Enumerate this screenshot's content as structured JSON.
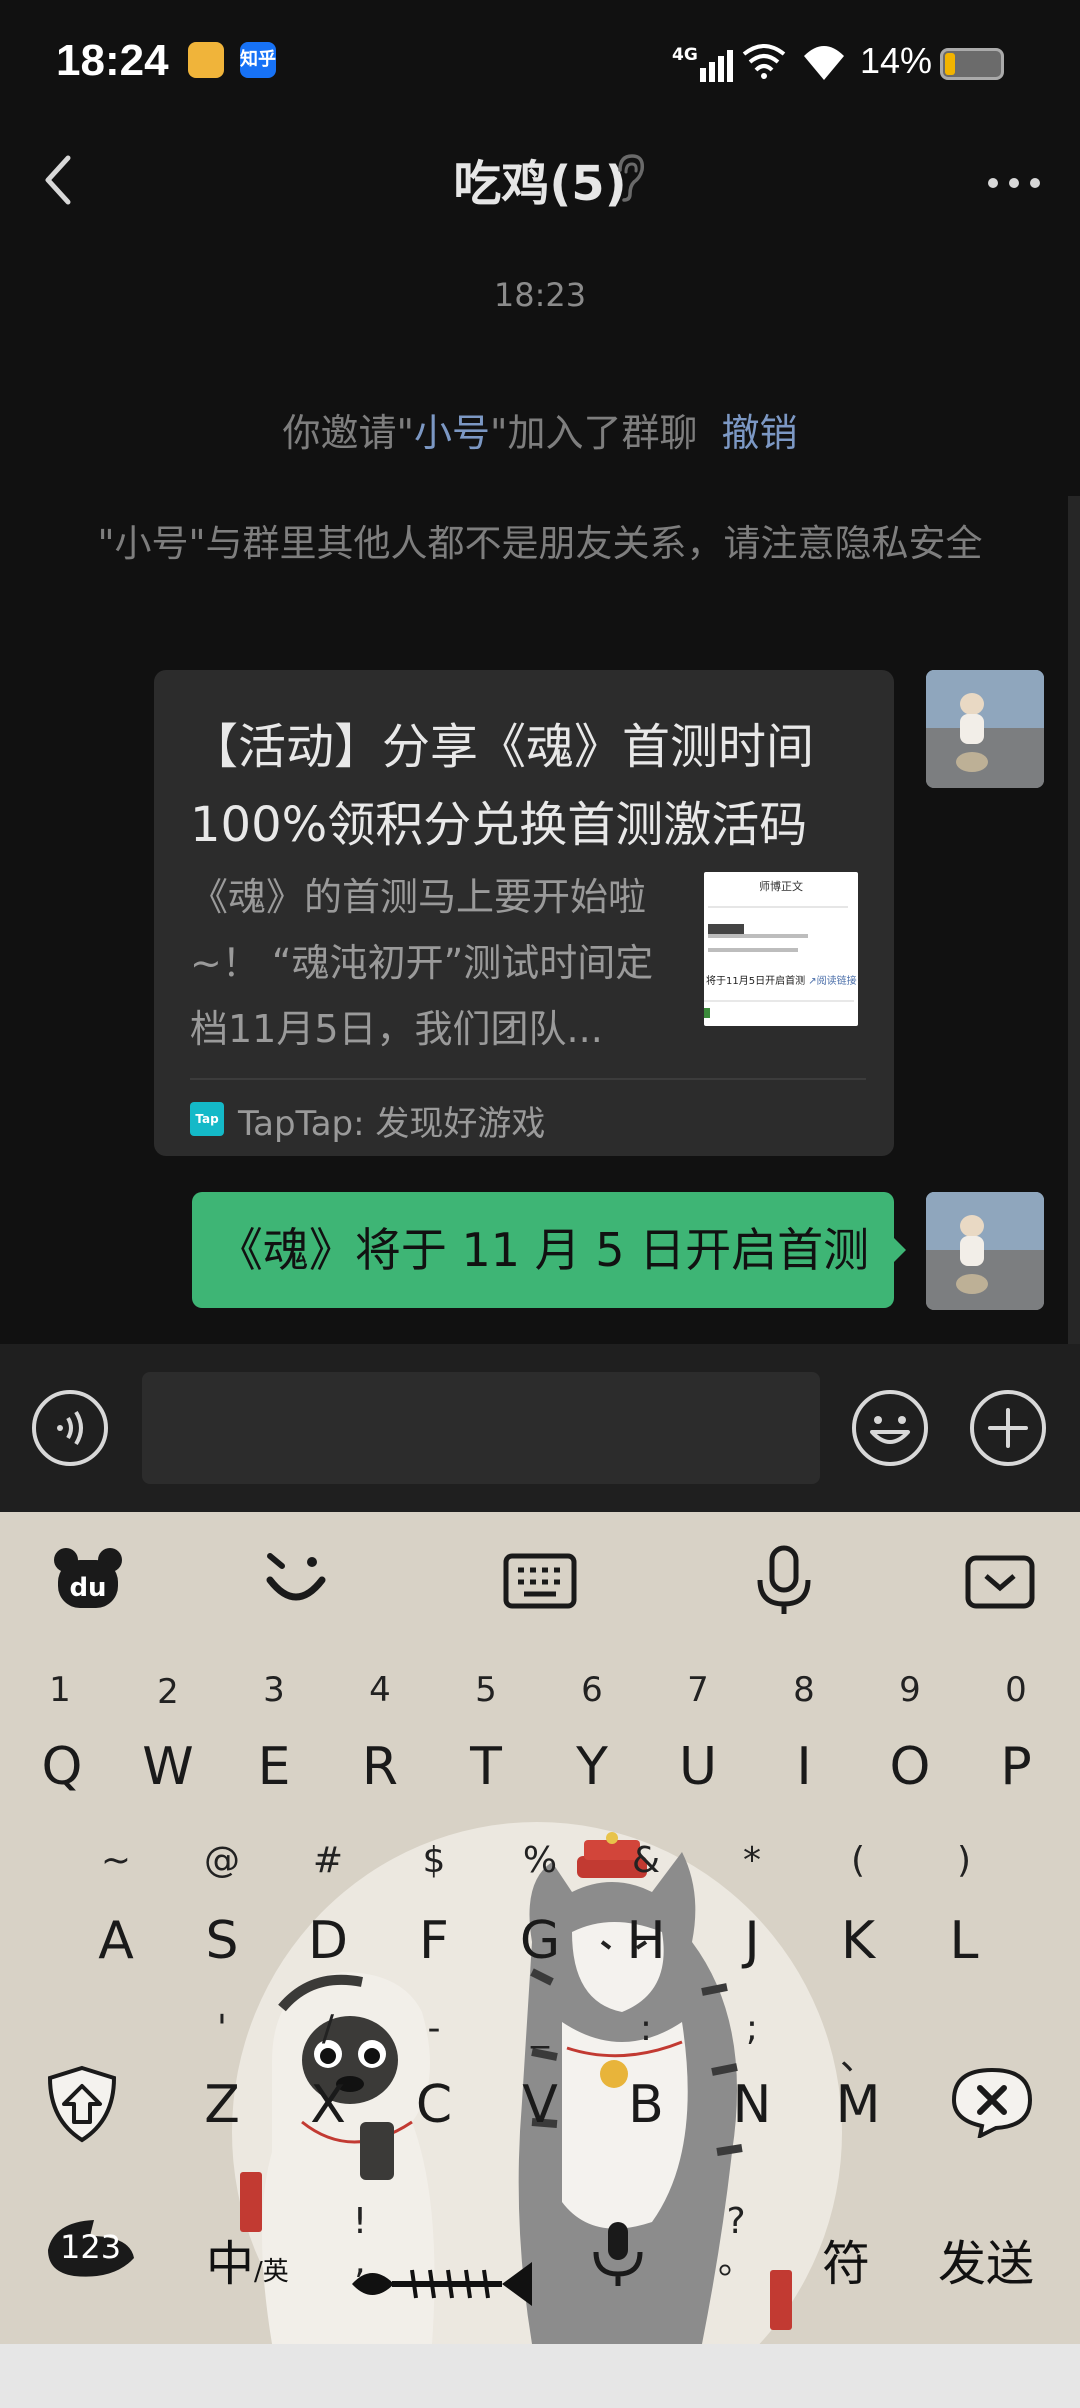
{
  "status_bar": {
    "time": "18:24",
    "network": "4G",
    "battery_percent": "14%",
    "app_icons": [
      "pay-icon",
      "zhihu-icon"
    ],
    "zhihu_label": "知乎"
  },
  "header": {
    "title": "吃鸡(5)",
    "back_icon": "chevron-left-icon",
    "mute_icon": "ear-icon",
    "more_icon": "more-horizontal-icon"
  },
  "messages": {
    "timestamp": "18:23",
    "invite_prefix": "你邀请\"",
    "invite_name": "小号",
    "invite_suffix": "\"加入了群聊",
    "invite_revoke": "撤销",
    "warning": "\"小号\"与群里其他人都不是朋友关系，请注意隐私安全",
    "card": {
      "title": "【活动】分享《魂》首测时间100%领积分兑换首测激活码 ...",
      "description": "《魂》的首测马上要开始啦~！ “魂沌初开”测试时间定档11月5日，我们团队...",
      "thumb_heading": "师博正文",
      "thumb_text": "将于11月5日开启首测",
      "thumb_link": "↗阅读链接",
      "source_icon_label": "Tap",
      "source": "TapTap: 发现好游戏"
    },
    "bubble": "《魂》将于 11 月 5 日开启首测"
  },
  "input": {
    "placeholder": "",
    "voice_icon": "voice-icon",
    "emoji_icon": "emoji-icon",
    "plus_icon": "plus-circle-icon"
  },
  "keyboard": {
    "toolbar": [
      "du-logo-icon",
      "smile-icon",
      "keyboard-icon",
      "microphone-icon",
      "collapse-icon"
    ],
    "numbers": [
      "1",
      "2",
      "3",
      "4",
      "5",
      "6",
      "7",
      "8",
      "9",
      "0"
    ],
    "row1": [
      "Q",
      "W",
      "E",
      "R",
      "T",
      "Y",
      "U",
      "I",
      "O",
      "P"
    ],
    "symbols_row2": [
      "~",
      "@",
      "#",
      "$",
      "%",
      "&",
      "*",
      "(",
      ")"
    ],
    "row2": [
      "A",
      "S",
      "D",
      "F",
      "G",
      "H",
      "J",
      "K",
      "L"
    ],
    "symbols_row3": [
      "'",
      "/",
      "-",
      "_",
      ":",
      ";",
      "、"
    ],
    "row3": [
      "Z",
      "X",
      "C",
      "V",
      "B",
      "N",
      "M"
    ],
    "key_123": "123",
    "key_lang_main": "中",
    "key_lang_sub": "/英",
    "key_punct_top": "!",
    "key_punct_bottom": ",",
    "key_question_top": "?",
    "key_question_bottom": "。",
    "key_symbols": "符",
    "key_send": "发送",
    "seal_left": "巴扎黑",
    "seal_right": "吾皇"
  }
}
